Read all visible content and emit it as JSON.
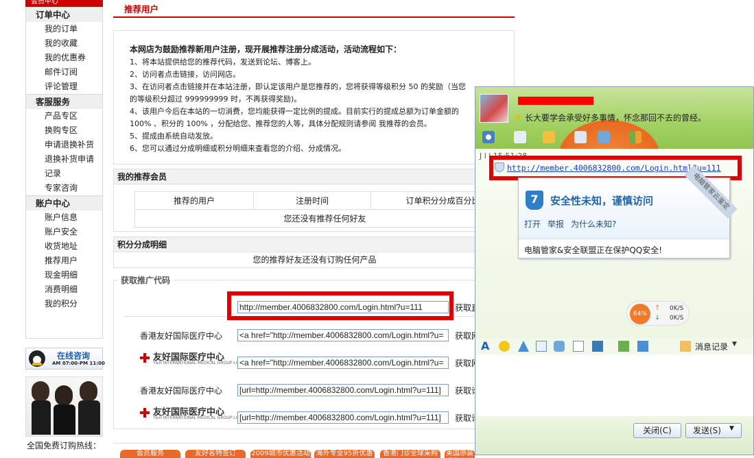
{
  "sidebar": {
    "top_label": "会员中心",
    "sections": [
      {
        "title": "订单中心",
        "items": [
          "我的订单",
          "我的收藏",
          "我的优惠券",
          "邮件订阅",
          "评论管理"
        ]
      },
      {
        "title": "客服服务",
        "items": [
          "产品专区",
          "换购专区",
          "申请退换补货",
          "退换补货申请",
          "记录",
          "专家咨询"
        ]
      },
      {
        "title": "账户中心",
        "items": [
          "账户信息",
          "账户安全",
          "收货地址",
          "推荐用户",
          "现金明细",
          "消费明细",
          "我的积分"
        ]
      }
    ],
    "online_label": "在线咨询",
    "online_hours": "AM 07:00-PM 11:00",
    "hotline": "全国免费订购热线："
  },
  "main": {
    "tab_title": "推荐用户",
    "intro_title": "本网店为鼓励推荐新用户注册，现开展推荐注册分成活动，活动流程如下：",
    "rules": [
      "1、将本站提供给您的推荐代码，发送到论坛、博客上。",
      "2、访问者点击链接，访问网店。",
      "3、在访问者点击链接并在本站注册，即认定该用户是您推荐的，您将获得等级积分 50 的奖励（当您",
      "的等级积分超过 999999999 时，不再获得奖励)。",
      "4、该用户今后在本站的一切消费，您均能获得一定比例的提成。目前实行的提成总额为订单金额的",
      "100% 、积分的 100% ，分配给您、推荐您的人等，具体分配规则请参阅 我推荐的会员。",
      "5、提成由系统自动发放。",
      "6、您可以通过分成明细或积分明细来查看您的介绍、分成情况。"
    ],
    "members_title": "我的推荐会员",
    "members_headers": [
      "推荐的用户",
      "注册时间",
      "订单积分分成百分比"
    ],
    "members_empty": "您还没有推荐任何好友",
    "points_title": "积分分成明细",
    "points_empty": "您的推荐好友还没有订购任何产品",
    "promo_title": "获取推广代码",
    "promo_rows": [
      {
        "label": "",
        "value": "http://member.4006832800.com/Login.html?u=111",
        "action": "获取直"
      },
      {
        "label": "香港友好国际医疗中心",
        "value": "<a href=\"http://member.4006832800.com/Login.html?u=",
        "action": "获取网"
      },
      {
        "label": "",
        "value": "<a href=\"http://member.4006832800.com/Login.html?u=",
        "action": "获取网"
      },
      {
        "label": "香港友好国际医疗中心",
        "value": "[url=http://member.4006832800.com/Login.html?u=111]",
        "action": "获取论"
      },
      {
        "label": "",
        "value": "[url=http://member.4006832800.com/Login.html?u=111]",
        "action": "获取论"
      }
    ],
    "logo_text": "友好国际医疗中心",
    "logo_sub": "Y&H INTERNATIONAL MEDICAL GROUP LIMITED",
    "bottom_tabs": [
      "会员服务",
      "友好名特签订",
      "2009城市优惠活动",
      "海外专业95折优惠",
      "香港门诊全球采购",
      "美国原装 香港直邮"
    ]
  },
  "qq": {
    "signature": "长大要学会承受好多事情，怀念那回不去的曾经。",
    "partial_line": "J   l   l   15:51:28",
    "link": "http://member.4006832800.com/Login.html?u=111",
    "security_title": "安全性未知，谨慎访问",
    "actions": [
      "打开",
      "举报",
      "为什么未知?"
    ],
    "corner": "电脑管家云鉴定",
    "footer": "电脑管家&安全联盟正在保护QQ安全!",
    "speed_pct": "64%",
    "up_speed": "0K/S",
    "down_speed": "0K/S",
    "history": "消息记录",
    "close_btn": "关闭(C)",
    "send_btn": "发送(S)",
    "colors": {
      "accent_red": "#e00000",
      "qq_green": "#9fcf5f"
    }
  }
}
